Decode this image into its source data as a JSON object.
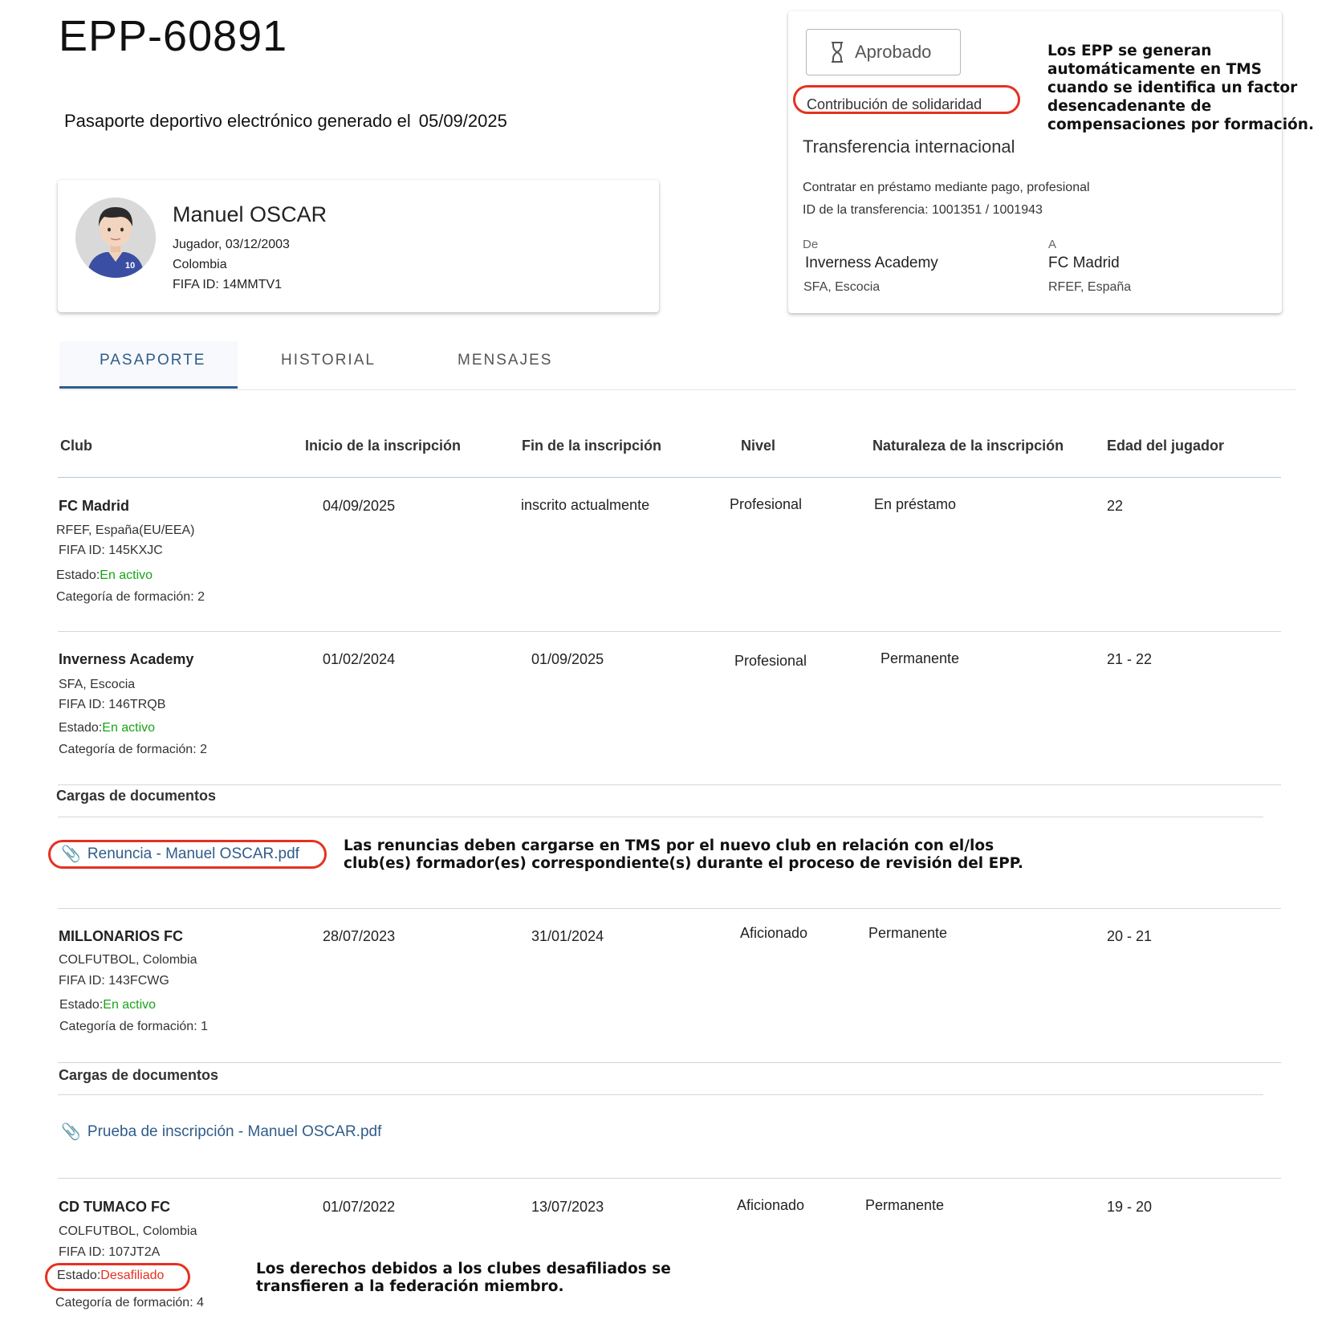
{
  "header": {
    "title": "EPP-60891",
    "generated_label": "Pasaporte deportivo electrónico generado el",
    "generated_date": "05/09/2025"
  },
  "player": {
    "name": "Manuel OSCAR",
    "role": "Jugador,",
    "birthdate": "03/12/2003",
    "country": "Colombia",
    "fifa_id": "FIFA ID: 14MMTV1",
    "shirt_number": "10"
  },
  "transfer": {
    "status": "Aprobado",
    "status_icon": "hourglass-icon",
    "type_tag": "Contribución de solidaridad",
    "type": "Transferencia internacional",
    "description": "Contratar en préstamo mediante pago, profesional",
    "transfer_id": "ID de la transferencia: 1001351 / 1001943",
    "from_label": "De",
    "from_club": "Inverness Academy",
    "from_fed": "SFA, Escocia",
    "to_label": "A",
    "to_club": "FC Madrid",
    "to_fed": "RFEF, España"
  },
  "notes": {
    "epp_info": [
      "Los EPP se generan",
      "automáticamente en TMS",
      "cuando se identifica un factor",
      "desencadenante de",
      "compensaciones por formación."
    ],
    "waiver_info": [
      "Las renuncias deben cargarse en TMS por el nuevo club en relación con el/los",
      "club(es) formador(es) correspondiente(s) durante el proceso de revisión del EPP."
    ],
    "disaffiliated_info": [
      "Los derechos debidos a los clubes desafiliados se",
      "transfieren a la federación miembro."
    ]
  },
  "tabs": [
    {
      "label": "PASAPORTE",
      "active": true
    },
    {
      "label": "HISTORIAL",
      "active": false
    },
    {
      "label": "MENSAJES",
      "active": false
    }
  ],
  "columns": [
    "Club",
    "Inicio de la inscripción",
    "Fin de la inscripción",
    "Nivel",
    "Naturaleza de la inscripción",
    "Edad del jugador"
  ],
  "status_prefix": "Estado:",
  "documents_label": "Cargas de documentos",
  "rows": [
    {
      "club": "FC Madrid",
      "federation": "RFEF, España(EU/EEA)",
      "fifa_id": "FIFA ID: 145KXJC",
      "status": "En activo",
      "category": "Categoría de formación: 2",
      "start": "04/09/2025",
      "end": "inscrito actualmente",
      "level": "Profesional",
      "nature": "En préstamo",
      "age": "22"
    },
    {
      "club": "Inverness Academy",
      "federation": "SFA, Escocia",
      "fifa_id": "FIFA ID: 146TRQB",
      "status": "En activo",
      "category": "Categoría de formación: 2",
      "start": "01/02/2024",
      "end": "01/09/2025",
      "level": "Profesional",
      "nature": "Permanente",
      "age": "21  - 22",
      "document_prefix": "Renuncia - ",
      "document_name": "Manuel OSCAR.pdf"
    },
    {
      "club": "MILLONARIOS FC",
      "federation": "COLFUTBOL, Colombia",
      "fifa_id": "FIFA ID: 143FCWG",
      "status": "En activo",
      "category": "Categoría de formación: 1",
      "start": "28/07/2023",
      "end": "31/01/2024",
      "level": "Aficionado",
      "nature": "Permanente",
      "age": "20 - 21",
      "document_prefix": "Prueba de inscripción - ",
      "document_name": "Manuel OSCAR.pdf"
    },
    {
      "club": "CD TUMACO FC",
      "federation": "COLFUTBOL, Colombia",
      "fifa_id": "FIFA ID: 107JT2A",
      "status": "Desafiliado",
      "category": "Categoría de formación: 4",
      "start": "01/07/2022",
      "end": "13/07/2023",
      "level": "Aficionado",
      "nature": "Permanente",
      "age": "19 - 20"
    }
  ],
  "colors": {
    "accent": "#2f5c8a",
    "active_status": "#19a319",
    "highlight": "#e53121"
  }
}
